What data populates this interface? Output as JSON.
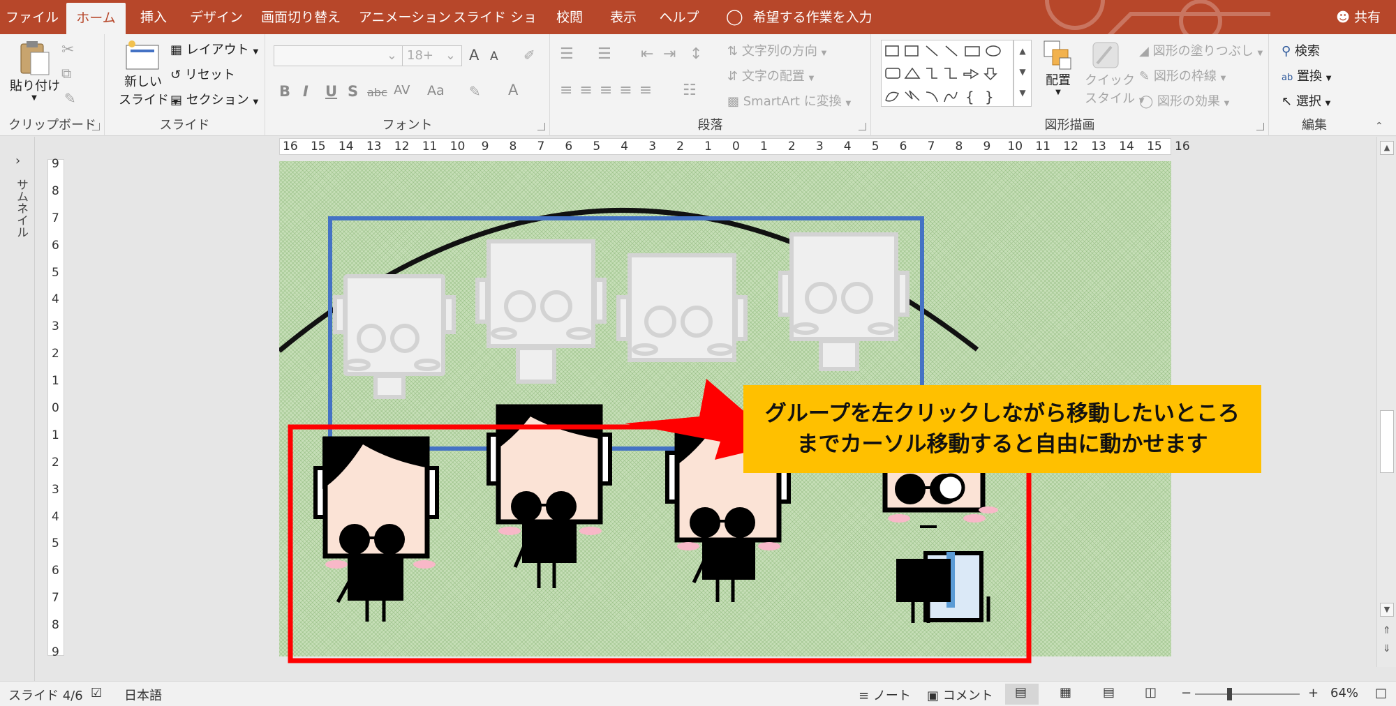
{
  "tabs": [
    "ファイル",
    "ホーム",
    "挿入",
    "デザイン",
    "画面切り替え",
    "アニメーション",
    "スライド ショー",
    "校閲",
    "表示",
    "ヘルプ"
  ],
  "active_tab": "ホーム",
  "tell_me": "希望する作業を入力",
  "share": "共有",
  "ribbon": {
    "clipboard": {
      "label": "クリップボード",
      "paste": "貼り付け"
    },
    "slides": {
      "label": "スライド",
      "new_slide_1": "新しい",
      "new_slide_2": "スライド",
      "layout": "レイアウト",
      "reset": "リセット",
      "section": "セクション"
    },
    "font": {
      "label": "フォント",
      "size_placeholder": "18+",
      "grow": "A",
      "shrink": "A",
      "bold": "B",
      "italic": "I",
      "underline": "U",
      "shadow": "S",
      "strike": "abc",
      "spacing": "AV",
      "case": "Aa",
      "color": "A"
    },
    "paragraph": {
      "label": "段落",
      "text_direction": "文字列の方向",
      "align_text": "文字の配置",
      "smartart": "SmartArt に変換"
    },
    "drawing": {
      "label": "図形描画",
      "arrange": "配置",
      "quick_styles_1": "クイック",
      "quick_styles_2": "スタイル",
      "fill": "図形の塗りつぶし",
      "outline": "図形の枠線",
      "effects": "図形の効果"
    },
    "editing": {
      "label": "編集",
      "find": "検索",
      "replace": "置換",
      "select": "選択"
    }
  },
  "thumbnails_label": "サムネイル",
  "hruler_ticks": [
    "16",
    "15",
    "14",
    "13",
    "12",
    "11",
    "10",
    "9",
    "8",
    "7",
    "6",
    "5",
    "4",
    "3",
    "2",
    "1",
    "0",
    "1",
    "2",
    "3",
    "4",
    "5",
    "6",
    "7",
    "8",
    "9",
    "10",
    "11",
    "12",
    "13",
    "14",
    "15",
    "16"
  ],
  "vruler_ticks": [
    "9",
    "8",
    "7",
    "6",
    "5",
    "4",
    "3",
    "2",
    "1",
    "0",
    "1",
    "2",
    "3",
    "4",
    "5",
    "6",
    "7",
    "8",
    "9"
  ],
  "callout": {
    "line1": "グループを左クリックしながら移動したいところ",
    "line2": "までカーソル移動すると自由に動かせます"
  },
  "status": {
    "slide": "スライド 4/6",
    "language": "日本語",
    "notes": "ノート",
    "comments": "コメント",
    "zoom": "64%"
  },
  "colors": {
    "accent": "#b7472a",
    "callout": "#ffc000",
    "blue_rect": "#4472c4",
    "red_rect": "#ff0000"
  }
}
